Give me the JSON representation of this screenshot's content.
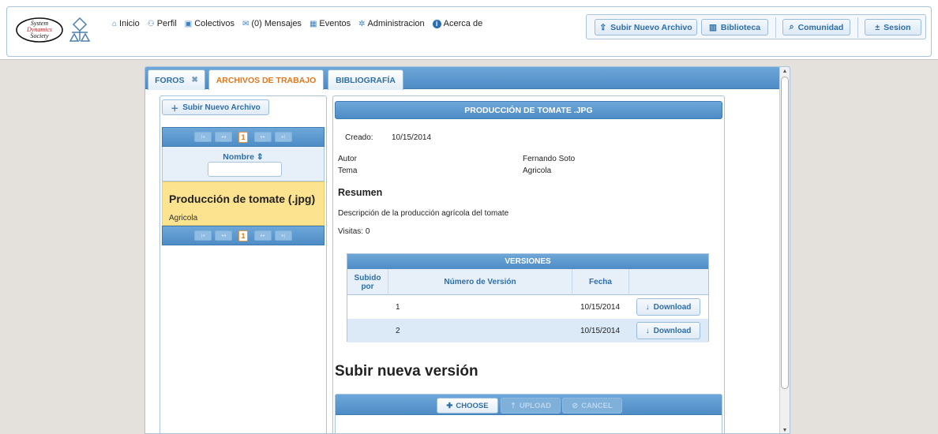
{
  "header": {
    "logo_text": [
      "System",
      "Dynamics",
      "Society"
    ],
    "nav": [
      {
        "label": "Inicio",
        "icon": "home-icon"
      },
      {
        "label": "Perfil",
        "icon": "user-icon"
      },
      {
        "label": "Colectivos",
        "icon": "group-icon"
      },
      {
        "label": "(0) Mensajes",
        "icon": "mail-icon"
      },
      {
        "label": "Eventos",
        "icon": "calendar-icon"
      },
      {
        "label": "Administracion",
        "icon": "gear-icon"
      },
      {
        "label": "Acerca de",
        "icon": "info-icon"
      }
    ],
    "actions": {
      "upload_label": "Subir Nuevo Archivo",
      "library_label": "Biblioteca",
      "community_label": "Comunidad",
      "session_label": "Sesion"
    }
  },
  "tabs": [
    {
      "label": "FOROS",
      "closable": true,
      "active": false
    },
    {
      "label": "ARCHIVOS DE TRABAJO",
      "closable": false,
      "active": true
    },
    {
      "label": "BIBLIOGRAFÍA",
      "closable": false,
      "active": false
    }
  ],
  "file_list": {
    "upload_button_label": "Subir Nuevo Archivo",
    "current_page": "1",
    "column_header": "Nombre",
    "filter_value": "",
    "items": [
      {
        "title": "Producción de tomate (.jpg)",
        "topic": "Agricola"
      }
    ]
  },
  "detail": {
    "header": "PRODUCCIÓN DE TOMATE .JPG",
    "created_label": "Creado:",
    "created_value": "10/15/2014",
    "author_label": "Autor",
    "author_value": "Fernando Soto",
    "topic_label": "Tema",
    "topic_value": "Agricola",
    "summary_heading": "Resumen",
    "summary_text": "Descripción de la producción agrícola del tomate",
    "visits": "Visitas: 0",
    "versions": {
      "title": "VERSIONES",
      "columns": [
        "Subido por",
        "Número de Versión",
        "Fecha"
      ],
      "rows": [
        {
          "uploaded_by": "",
          "version": "1",
          "date": "10/15/2014",
          "action": "Download"
        },
        {
          "uploaded_by": "",
          "version": "2",
          "date": "10/15/2014",
          "action": "Download"
        }
      ]
    },
    "upload_heading": "Subir nueva versión",
    "uploader": {
      "choose_label": "CHOOSE",
      "upload_label": "UPLOAD",
      "cancel_label": "CANCEL"
    }
  },
  "colors": {
    "accent_blue": "#4e8cc6",
    "active_tab_orange": "#e1771a",
    "selected_row_yellow": "#fbe38f"
  }
}
